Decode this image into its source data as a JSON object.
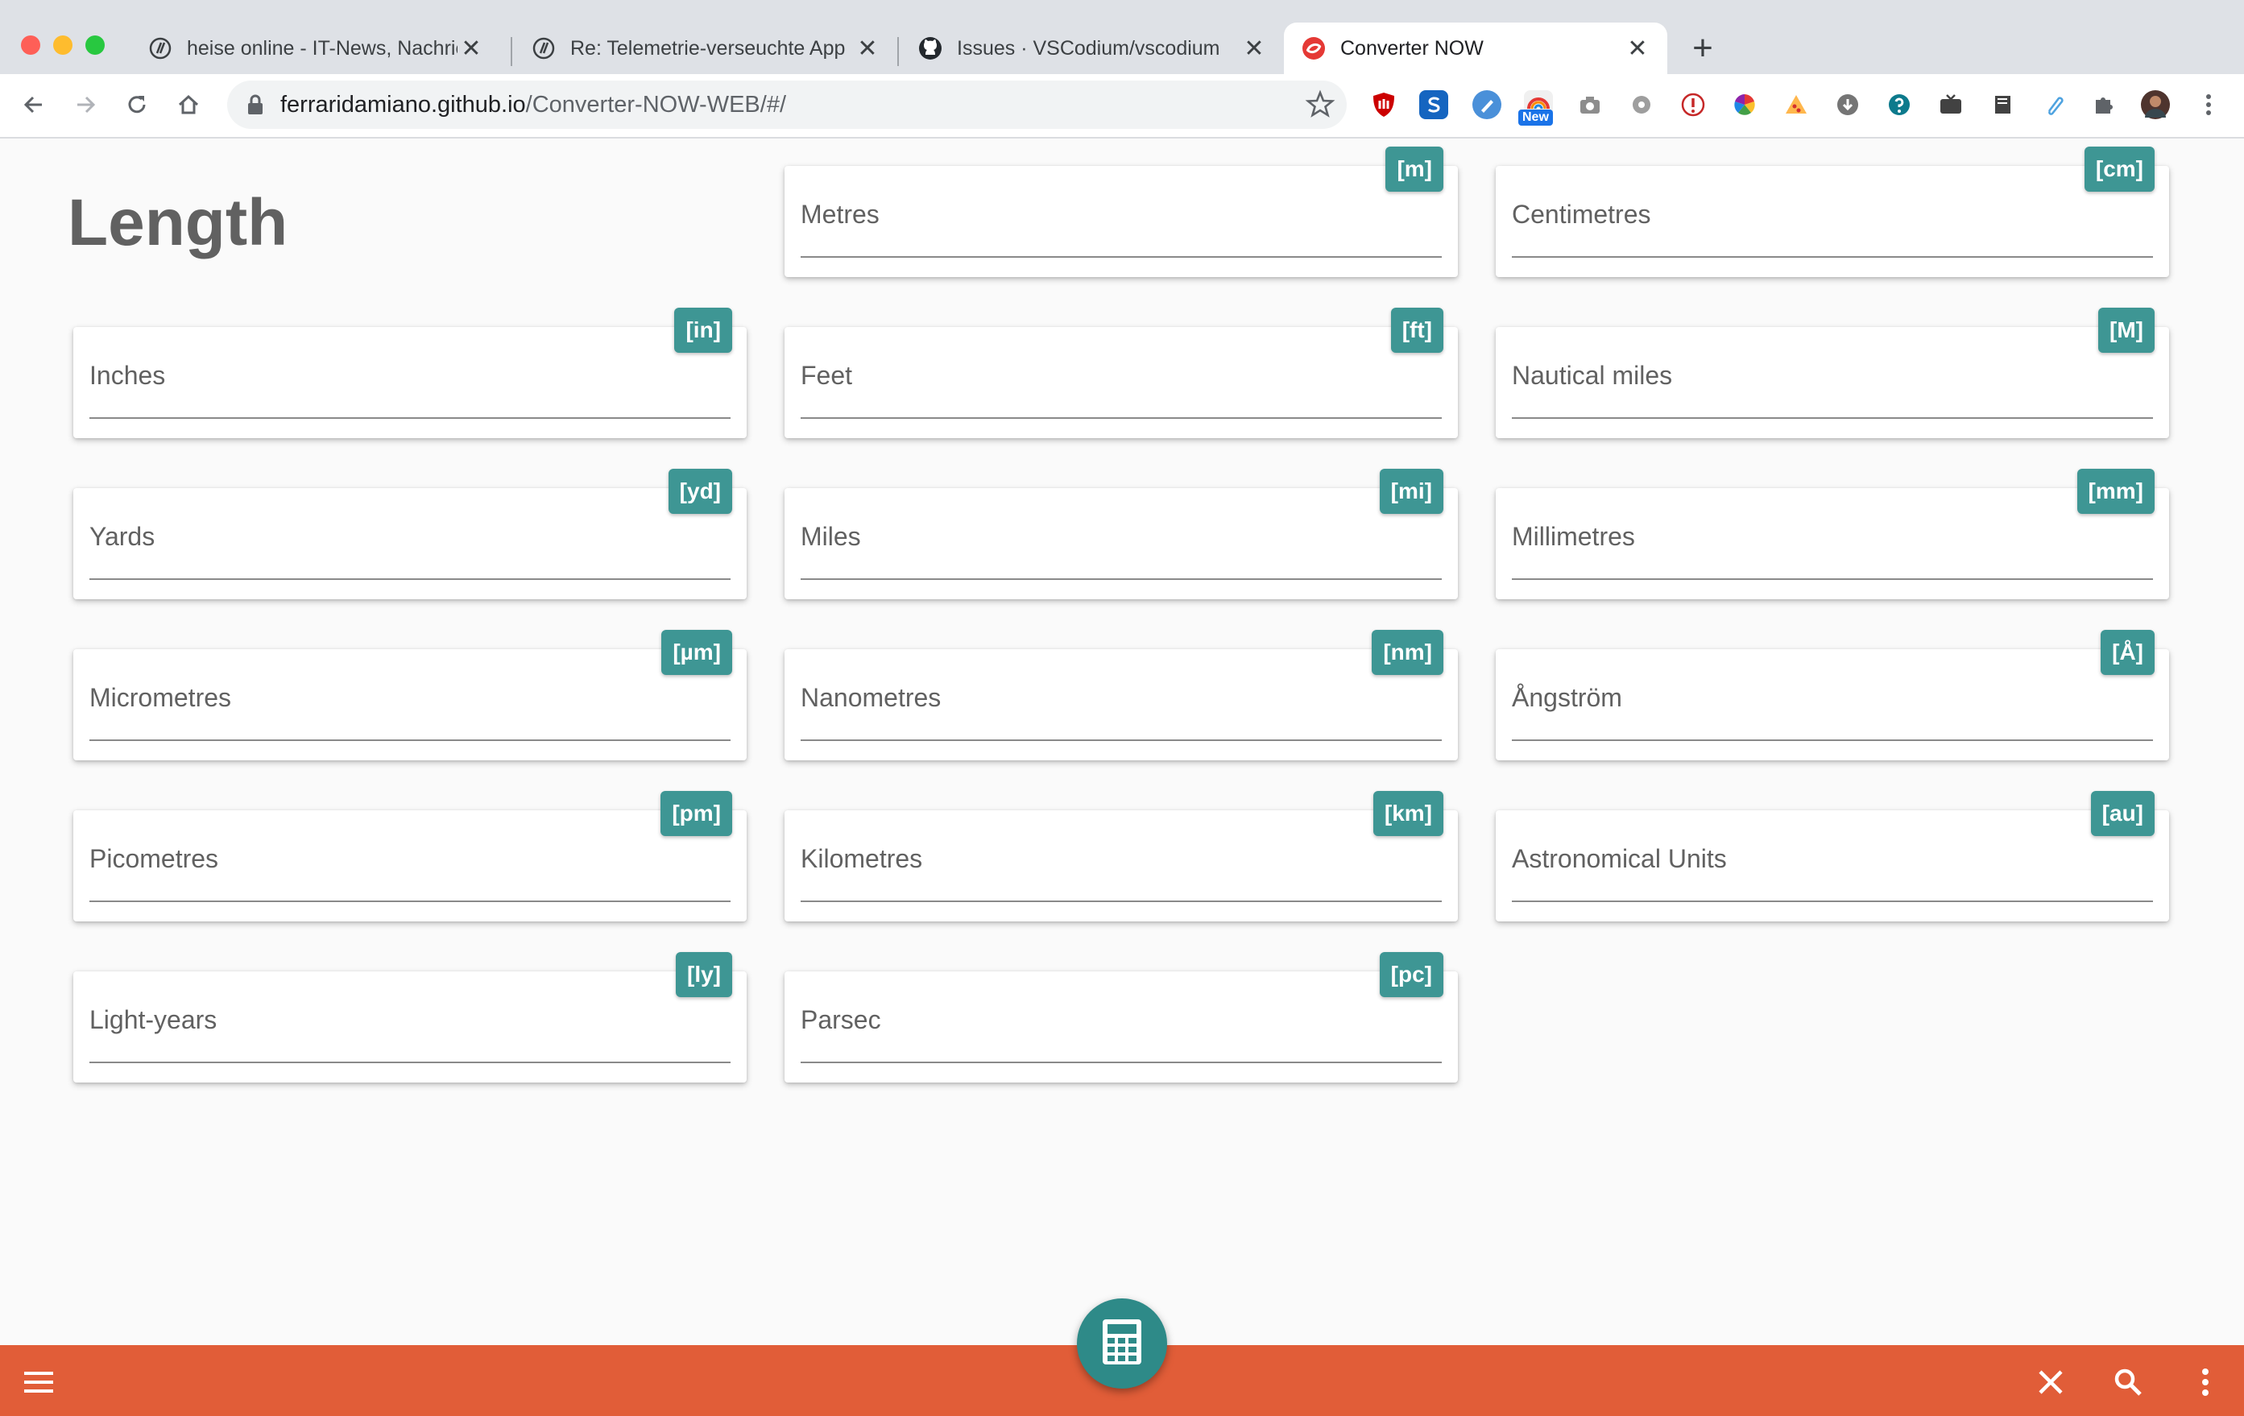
{
  "browser": {
    "tabs": [
      {
        "title": "heise online - IT-News, Nachric",
        "active": false
      },
      {
        "title": "Re: Telemetrie-verseuchte App",
        "active": false
      },
      {
        "title": "Issues · VSCodium/vscodium",
        "active": false
      },
      {
        "title": "Converter NOW",
        "active": true
      }
    ],
    "url_host": "ferraridamiano.github.io",
    "url_path": "/Converter-NOW-WEB/#/",
    "extension_badge": "New"
  },
  "page": {
    "title": "Length"
  },
  "units": [
    {
      "name": "Metres",
      "symbol": "[m]",
      "value": ""
    },
    {
      "name": "Centimetres",
      "symbol": "[cm]",
      "value": ""
    },
    {
      "name": "Inches",
      "symbol": "[in]",
      "value": ""
    },
    {
      "name": "Feet",
      "symbol": "[ft]",
      "value": ""
    },
    {
      "name": "Nautical miles",
      "symbol": "[M]",
      "value": ""
    },
    {
      "name": "Yards",
      "symbol": "[yd]",
      "value": ""
    },
    {
      "name": "Miles",
      "symbol": "[mi]",
      "value": ""
    },
    {
      "name": "Millimetres",
      "symbol": "[mm]",
      "value": ""
    },
    {
      "name": "Micrometres",
      "symbol": "[µm]",
      "value": ""
    },
    {
      "name": "Nanometres",
      "symbol": "[nm]",
      "value": ""
    },
    {
      "name": "Ångström",
      "symbol": "[Å]",
      "value": ""
    },
    {
      "name": "Picometres",
      "symbol": "[pm]",
      "value": ""
    },
    {
      "name": "Kilometres",
      "symbol": "[km]",
      "value": ""
    },
    {
      "name": "Astronomical Units",
      "symbol": "[au]",
      "value": ""
    },
    {
      "name": "Light-years",
      "symbol": "[ly]",
      "value": ""
    },
    {
      "name": "Parsec",
      "symbol": "[pc]",
      "value": ""
    }
  ],
  "colors": {
    "accent": "#e15d38",
    "badge": "#3e9694",
    "fab": "#2e8a88"
  }
}
